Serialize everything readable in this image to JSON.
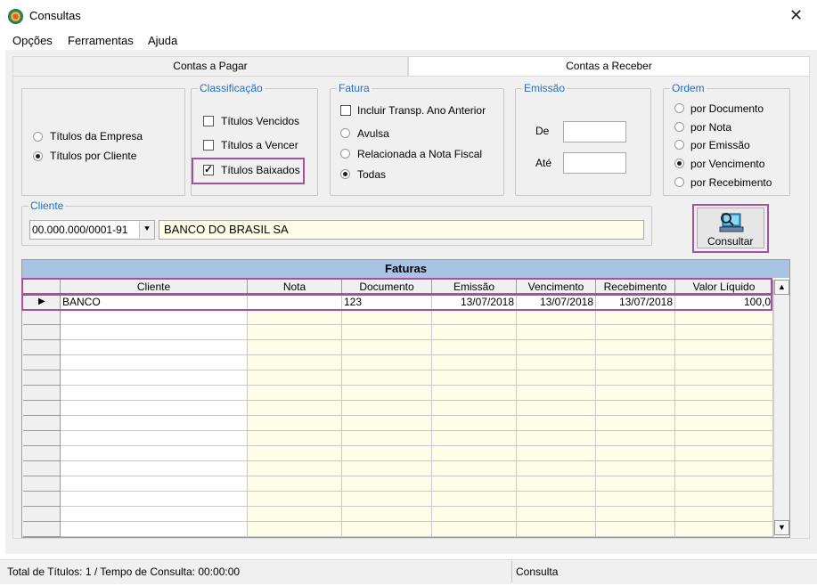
{
  "window": {
    "title": "Consultas"
  },
  "menu": [
    "Opções",
    "Ferramentas",
    "Ajuda"
  ],
  "tabs": [
    {
      "label": "Contas a Pagar",
      "active": false
    },
    {
      "label": "Contas a Receber",
      "active": true
    }
  ],
  "titulos": {
    "options": [
      "Títulos da Empresa",
      "Títulos por Cliente"
    ],
    "selected": "Títulos por Cliente"
  },
  "classificacao": {
    "legend": "Classificação",
    "options": [
      {
        "label": "Títulos Vencidos",
        "checked": false
      },
      {
        "label": "Títulos a Vencer",
        "checked": false
      },
      {
        "label": "Títulos Baixados",
        "checked": true
      }
    ]
  },
  "fatura": {
    "legend": "Fatura",
    "checkbox": {
      "label": "Incluir Transp. Ano Anterior",
      "checked": false
    },
    "options": [
      "Avulsa",
      "Relacionada a Nota Fiscal",
      "Todas"
    ],
    "selected": "Todas"
  },
  "emissao": {
    "legend": "Emissão",
    "de_label": "De",
    "ate_label": "Até",
    "de_value": "",
    "ate_value": ""
  },
  "ordem": {
    "legend": "Ordem",
    "options": [
      "por Documento",
      "por Nota",
      "por Emissão",
      "por Vencimento",
      "por Recebimento"
    ],
    "selected": "por Vencimento"
  },
  "cliente": {
    "legend": "Cliente",
    "cnpj": "00.000.000/0001-91",
    "name": "BANCO DO BRASIL SA"
  },
  "consultar_label": "Consultar",
  "grid": {
    "title": "Faturas",
    "columns": [
      "Cliente",
      "Nota",
      "Documento",
      "Emissão",
      "Vencimento",
      "Recebimento",
      "Valor Líquido"
    ],
    "rows": [
      [
        "BANCO",
        "",
        "123",
        "13/07/2018",
        "13/07/2018",
        "13/07/2018",
        "100,0"
      ]
    ],
    "empty_rows": 15
  },
  "status": {
    "left": "Total de Títulos: 1 / Tempo de Consulta: 00:00:00",
    "right": "Consulta"
  },
  "colors": {
    "highlight": "#a54fa5",
    "legend": "#1b6fd1",
    "grid_title": "#a9c4e3",
    "row_bg": "#fefee8"
  }
}
